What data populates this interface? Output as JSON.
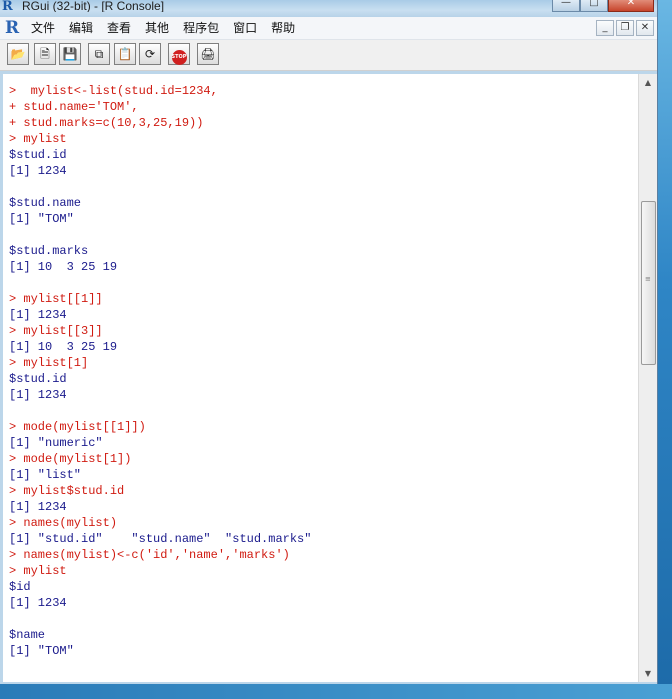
{
  "window": {
    "title": "RGui (32-bit) - [R Console]"
  },
  "menubar": {
    "items": [
      "文件",
      "编辑",
      "查看",
      "其他",
      "程序包",
      "窗口",
      "帮助"
    ]
  },
  "toolbar": {
    "buttons": [
      "open-script",
      "load-workspace",
      "save-workspace",
      "copy",
      "paste",
      "copy-paste",
      "stop",
      "print"
    ]
  },
  "console": {
    "lines": [
      {
        "kind": "in",
        "text": ">  mylist<-list(stud.id=1234,"
      },
      {
        "kind": "in",
        "text": "+ stud.name='TOM',"
      },
      {
        "kind": "in",
        "text": "+ stud.marks=c(10,3,25,19))"
      },
      {
        "kind": "in",
        "text": "> mylist"
      },
      {
        "kind": "out",
        "text": "$stud.id"
      },
      {
        "kind": "out",
        "text": "[1] 1234"
      },
      {
        "kind": "out",
        "text": ""
      },
      {
        "kind": "out",
        "text": "$stud.name"
      },
      {
        "kind": "out",
        "text": "[1] \"TOM\""
      },
      {
        "kind": "out",
        "text": ""
      },
      {
        "kind": "out",
        "text": "$stud.marks"
      },
      {
        "kind": "out",
        "text": "[1] 10  3 25 19"
      },
      {
        "kind": "out",
        "text": ""
      },
      {
        "kind": "in",
        "text": "> mylist[[1]]"
      },
      {
        "kind": "out",
        "text": "[1] 1234"
      },
      {
        "kind": "in",
        "text": "> mylist[[3]]"
      },
      {
        "kind": "out",
        "text": "[1] 10  3 25 19"
      },
      {
        "kind": "in",
        "text": "> mylist[1]"
      },
      {
        "kind": "out",
        "text": "$stud.id"
      },
      {
        "kind": "out",
        "text": "[1] 1234"
      },
      {
        "kind": "out",
        "text": ""
      },
      {
        "kind": "in",
        "text": "> mode(mylist[[1]])"
      },
      {
        "kind": "out",
        "text": "[1] \"numeric\""
      },
      {
        "kind": "in",
        "text": "> mode(mylist[1])"
      },
      {
        "kind": "out",
        "text": "[1] \"list\""
      },
      {
        "kind": "in",
        "text": "> mylist$stud.id"
      },
      {
        "kind": "out",
        "text": "[1] 1234"
      },
      {
        "kind": "in",
        "text": "> names(mylist)"
      },
      {
        "kind": "out",
        "text": "[1] \"stud.id\"    \"stud.name\"  \"stud.marks\""
      },
      {
        "kind": "in",
        "text": "> names(mylist)<-c('id','name','marks')"
      },
      {
        "kind": "in",
        "text": "> mylist"
      },
      {
        "kind": "out",
        "text": "$id"
      },
      {
        "kind": "out",
        "text": "[1] 1234"
      },
      {
        "kind": "out",
        "text": ""
      },
      {
        "kind": "out",
        "text": "$name"
      },
      {
        "kind": "out",
        "text": "[1] \"TOM\""
      }
    ]
  },
  "colors": {
    "input": "#d01a10",
    "output": "#1a1a8c"
  }
}
